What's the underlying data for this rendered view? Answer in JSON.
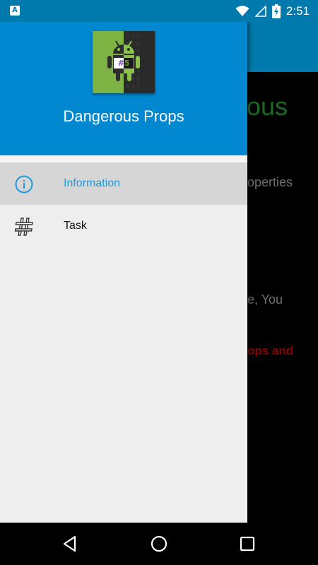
{
  "status_bar": {
    "left_icon": "A",
    "time": "2:51",
    "battery_level": "charging"
  },
  "background": {
    "title_fragment": "ous",
    "line1_fragment": "operties",
    "line2_fragment": "e, You",
    "line3_fragment": "ops and",
    "toolbar_color": "#0079ad"
  },
  "drawer": {
    "header_color": "#0288d1",
    "app_name": "Dangerous Props",
    "logo_badge": "#5",
    "menu": [
      {
        "label": "Information",
        "icon": "info-icon",
        "active": true
      },
      {
        "label": "Task",
        "icon": "hashtag-icon",
        "active": false
      }
    ]
  },
  "nav_bar": {
    "back": "back-icon",
    "home": "home-icon",
    "recents": "recents-icon"
  }
}
